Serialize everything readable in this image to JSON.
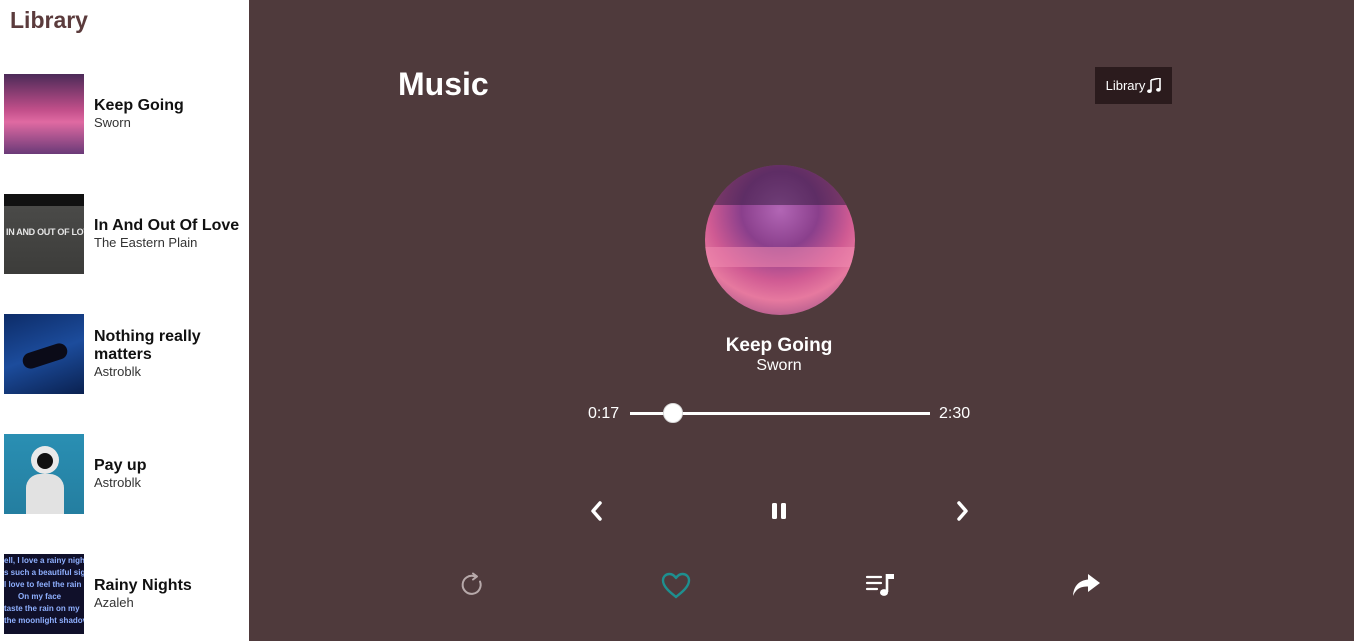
{
  "sidebar": {
    "title": "Library",
    "items": [
      {
        "title": "Keep Going",
        "artist": "Sworn"
      },
      {
        "title": "In And Out Of Love",
        "artist": "The Eastern Plain",
        "thumb_text": "IN AND OUT OF LOVE"
      },
      {
        "title": "Nothing really matters",
        "artist": "Astroblk"
      },
      {
        "title": "Pay up",
        "artist": "Astroblk"
      },
      {
        "title": "Rainy Nights",
        "artist": "Azaleh",
        "thumb_lines": [
          "ell, I love a rainy nigh",
          "s such a beautiful sig",
          "l love to feel the rain",
          "On my face",
          "taste the rain on my",
          "the moonlight shadov"
        ]
      }
    ]
  },
  "header": {
    "title": "Music",
    "library_button_label": "Library"
  },
  "player": {
    "track_title": "Keep Going",
    "track_artist": "Sworn",
    "current_time": "0:17",
    "total_time": "2:30",
    "progress_fraction": 0.143
  },
  "icons": {
    "library": "music-note-icon",
    "prev": "chevron-left-icon",
    "play_pause": "pause-icon",
    "next": "chevron-right-icon",
    "repeat": "repeat-icon",
    "favorite": "heart-icon",
    "playlist": "playlist-icon",
    "share": "share-icon"
  },
  "colors": {
    "main_bg": "#4f3a3c",
    "sidebar_title": "#5b3b3c",
    "library_button_bg": "#2b1b1d",
    "heart": "#1e8f8f"
  }
}
